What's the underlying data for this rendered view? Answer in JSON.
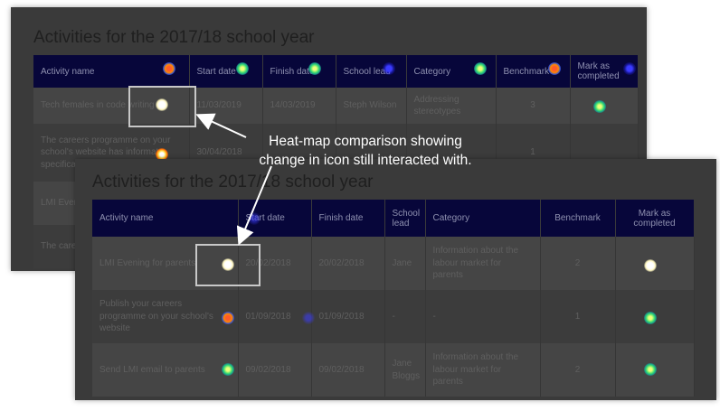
{
  "back_panel": {
    "title": "Activities for the 2017/18 school year",
    "columns": [
      "Activity name",
      "Start date",
      "Finish date",
      "School lead",
      "Category",
      "Benchmark",
      "Mark as completed"
    ],
    "rows": [
      {
        "name": "Tech females in code writing",
        "start": "11/03/2019",
        "finish": "14/03/2019",
        "lead": "Steph Wilson",
        "category": "Addressing stereotypes",
        "benchmark": "3"
      },
      {
        "name": "The careers programme on your school's website has informat... specifica...",
        "start": "30/04/2018",
        "finish": "",
        "lead": "",
        "category": "",
        "benchmark": "1"
      },
      {
        "name": "LMI Even...",
        "start": "",
        "finish": "",
        "lead": "",
        "category": "",
        "benchmark": ""
      },
      {
        "name": "The care... your sch...",
        "start": "",
        "finish": "",
        "lead": "",
        "category": "",
        "benchmark": ""
      }
    ]
  },
  "front_panel": {
    "title": "Activities for the 2017/18 school year",
    "columns": [
      "Activity name",
      "Start date",
      "Finish date",
      "School lead",
      "Category",
      "Benchmark",
      "Mark as completed"
    ],
    "rows": [
      {
        "name": "LMI Evening for parents",
        "start": "20/02/2018",
        "finish": "20/02/2018",
        "lead": "Jane",
        "category": "Information about the labour market for parents",
        "benchmark": "2"
      },
      {
        "name": "Publish your careers programme on your school's website",
        "start": "01/09/2018",
        "finish": "01/09/2018",
        "lead": "-",
        "category": "-",
        "benchmark": "1"
      },
      {
        "name": "Send LMI email to parents",
        "start": "09/02/2018",
        "finish": "09/02/2018",
        "lead": "Jane Bloggs",
        "category": "Information about the labour market for parents",
        "benchmark": "2"
      }
    ]
  },
  "callout": {
    "line1": "Heat-map comparison showing",
    "line2": "change in icon still interacted with."
  },
  "colors": {
    "panel_bg": "#3a3a3a",
    "header_bg": "#07063a",
    "highlight_box": "#c8c8c8"
  }
}
